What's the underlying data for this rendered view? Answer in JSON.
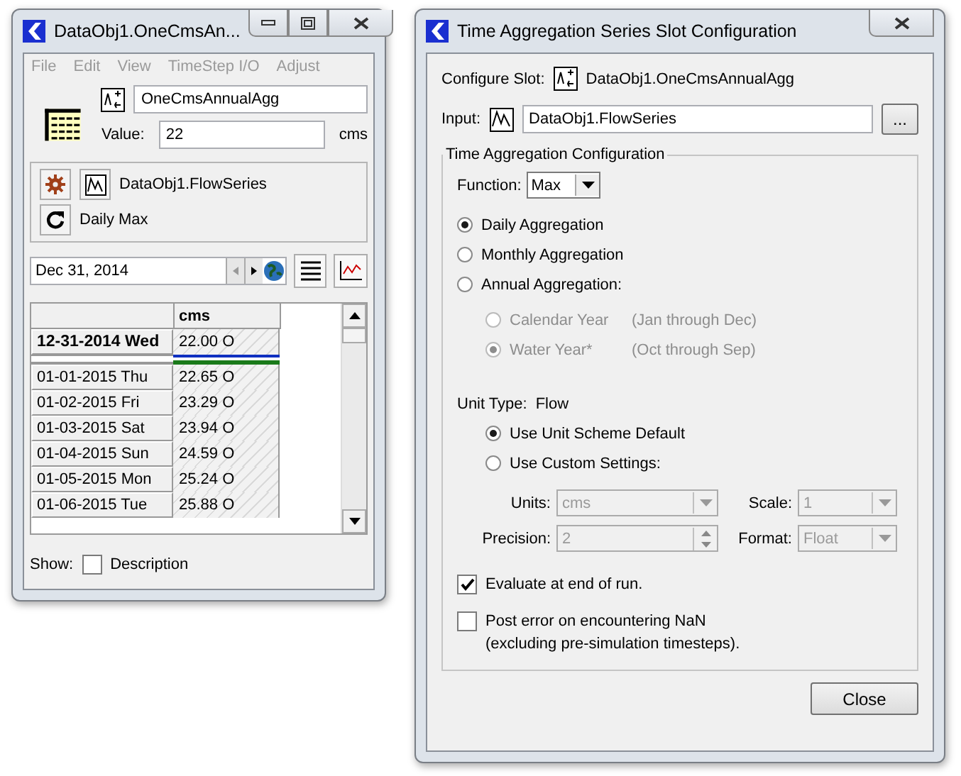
{
  "left_window": {
    "title": "DataObj1.OneCmsAn...",
    "menu": [
      {
        "label": "File",
        "disabled": true
      },
      {
        "label": "Edit",
        "disabled": true
      },
      {
        "label": "View",
        "disabled": true
      },
      {
        "label": "TimeStep I/O",
        "disabled": true
      },
      {
        "label": "Adjust",
        "disabled": true
      }
    ],
    "slot_name": "OneCmsAnnualAgg",
    "value_label": "Value:",
    "value": "22",
    "value_unit": "cms",
    "input_series": "DataObj1.FlowSeries",
    "aggregation": "Daily Max",
    "date": "Dec 31, 2014",
    "table": {
      "columns": [
        "cms"
      ],
      "current_row": {
        "date": "12-31-2014 Wed",
        "value": "22.00",
        "flag": "O"
      },
      "rows": [
        {
          "date": "01-01-2015 Thu",
          "value": "22.65",
          "flag": "O"
        },
        {
          "date": "01-02-2015 Fri",
          "value": "23.29",
          "flag": "O"
        },
        {
          "date": "01-03-2015 Sat",
          "value": "23.94",
          "flag": "O"
        },
        {
          "date": "01-04-2015 Sun",
          "value": "24.59",
          "flag": "O"
        },
        {
          "date": "01-05-2015 Mon",
          "value": "25.24",
          "flag": "O"
        },
        {
          "date": "01-06-2015 Tue",
          "value": "25.88",
          "flag": "O"
        }
      ]
    },
    "show_label": "Show:",
    "description": {
      "label": "Description",
      "checked": false
    }
  },
  "right_window": {
    "title": "Time Aggregation Series Slot Configuration",
    "configure_slot_label": "Configure Slot:",
    "configure_slot": "DataObj1.OneCmsAnnualAgg",
    "input_label": "Input:",
    "input": "DataObj1.FlowSeries",
    "browse_button": "...",
    "group_title": "Time Aggregation Configuration",
    "function_label": "Function:",
    "function": "Max",
    "aggregations": [
      {
        "label": "Daily Aggregation",
        "selected": true
      },
      {
        "label": "Monthly Aggregation",
        "selected": false
      },
      {
        "label": "Annual Aggregation:",
        "selected": false
      }
    ],
    "year_types": [
      {
        "label": "Calendar Year",
        "note": "(Jan through Dec)",
        "selected": false,
        "disabled": true
      },
      {
        "label": "Water Year*",
        "note": "(Oct through Sep)",
        "selected": true,
        "disabled": true
      }
    ],
    "unit_type_label": "Unit Type:",
    "unit_type": "Flow",
    "unit_options": [
      {
        "label": "Use Unit Scheme Default",
        "selected": true
      },
      {
        "label": "Use Custom Settings:",
        "selected": false
      }
    ],
    "fields": [
      {
        "label": "Units:",
        "value": "cms",
        "kind": "dropdown",
        "disabled": true
      },
      {
        "label": "Scale:",
        "value": "1",
        "kind": "dropdown",
        "disabled": true
      },
      {
        "label": "Precision:",
        "value": "2",
        "kind": "spinner",
        "disabled": true
      },
      {
        "label": "Format:",
        "value": "Float",
        "kind": "dropdown",
        "disabled": true
      }
    ],
    "checkboxes": [
      {
        "label": "Evaluate at end of run.",
        "checked": true
      },
      {
        "label": "Post error on encountering NaN\n(excluding pre-simulation timesteps).",
        "checked": false
      }
    ],
    "close_button": "Close"
  }
}
